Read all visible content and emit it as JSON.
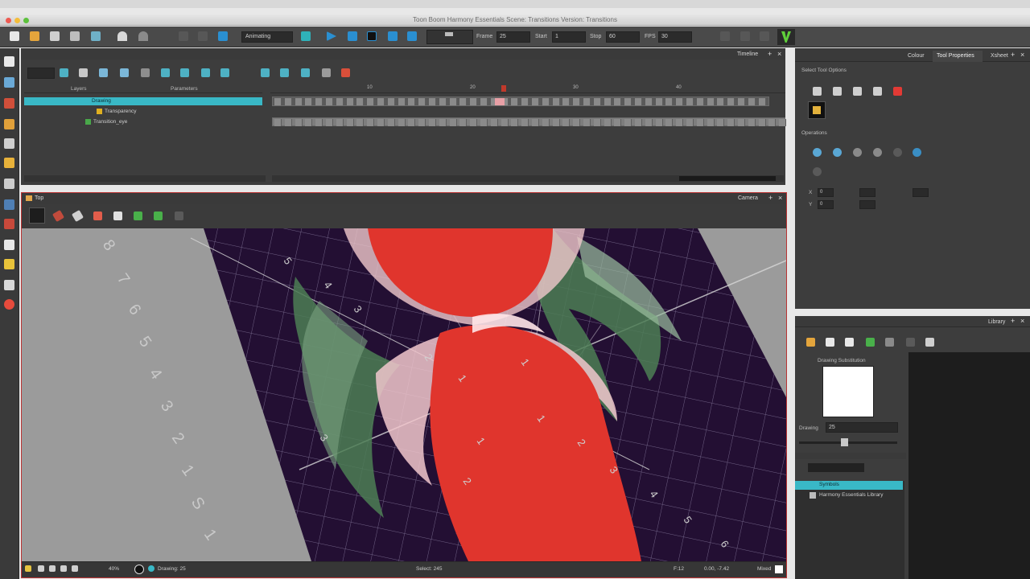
{
  "window": {
    "mac_top_text": "",
    "title": "Toon Boom Harmony Essentials Scene: Transitions Version: Transitions"
  },
  "toolbar": {
    "mode_select": "Animating",
    "frame_label": "Frame",
    "frame_value": "25",
    "start_label": "Start",
    "start_value": "1",
    "stop_label": "Stop",
    "stop_value": "60",
    "fps_label": "FPS",
    "fps_value": "30"
  },
  "timeline": {
    "tab": "Timeline",
    "layers_header": "Layers",
    "params_header": "Parameters",
    "layers": [
      {
        "name": "Drawing",
        "color": "#39b8c6"
      },
      {
        "name": "Transparency",
        "color": "#e0b020"
      },
      {
        "name": "Transition_eye",
        "color": "#49a84a"
      }
    ],
    "frame_numbers": [
      "10",
      "20",
      "30",
      "40"
    ],
    "current_frame": "25"
  },
  "camera": {
    "top_tab": "Top",
    "view_tab": "Camera",
    "status_zoom": "40%",
    "status_drawing": "Drawing: 25",
    "status_select": "Select: 245",
    "status_field": "F:12",
    "status_coords": "0.00, -7.42",
    "status_mode": "Mixed"
  },
  "tool_properties": {
    "tabs": [
      "Colour",
      "Tool Properties",
      "Xsheet"
    ],
    "active_tab": "Tool Properties",
    "section_select": "Select Tool Options",
    "section_operations": "Operations",
    "x_label": "X",
    "y_label": "Y",
    "x_value": "0",
    "y_value": "0"
  },
  "library": {
    "tab": "Library",
    "drawing_substitution": "Drawing Substitution",
    "drawing_label": "Drawing",
    "drawing_value": "25",
    "tree": [
      {
        "label": "Symbols",
        "selected": true
      },
      {
        "label": "Harmony Essentials Library",
        "selected": false
      }
    ]
  },
  "colors": {
    "panel": "#3d3d3d",
    "accent_teal": "#39b8c6",
    "red_shape": "#e0352d",
    "grid_bg": "#230f33",
    "green_shape": "#4c7e55"
  }
}
